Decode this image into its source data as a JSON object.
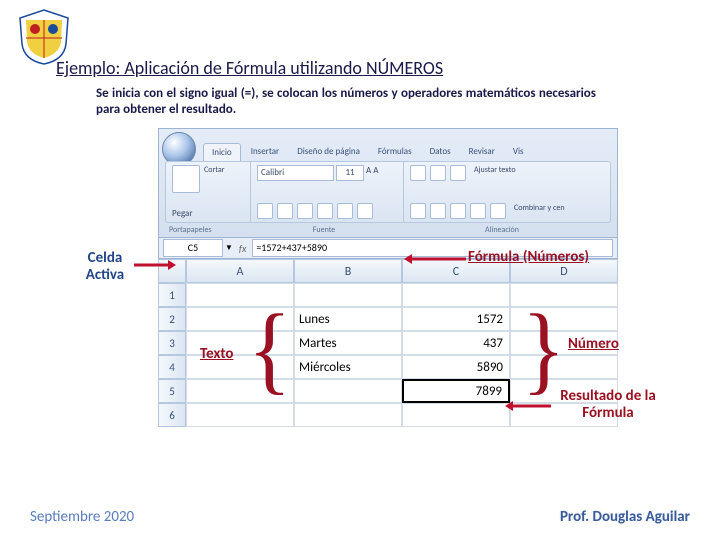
{
  "title": "Ejemplo: Aplicación de Fórmula utilizando NÚMEROS",
  "description": "Se inicia con el signo igual (=), se colocan los números y operadores matemáticos necesarios para obtener el resultado.",
  "callouts": {
    "celda_activa": "Celda Activa",
    "formula_numeros": "Fórmula (Números)",
    "texto": "Texto",
    "numero": "Número",
    "resultado": "Resultado de la Fórmula"
  },
  "ribbon": {
    "tabs": [
      "Inicio",
      "Insertar",
      "Diseño de página",
      "Fórmulas",
      "Datos",
      "Revisar",
      "Vis"
    ],
    "groups": [
      "Portapapeles",
      "Fuente",
      "Alineación"
    ],
    "paste": "Pegar",
    "cortar": "Cortar",
    "ajustar": "Ajustar texto",
    "combinar": "Combinar y cen",
    "font_name": "Calibri",
    "font_size": "11"
  },
  "formula_bar": {
    "namebox": "C5",
    "fx": "fx",
    "formula": "=1572+437+5890"
  },
  "columns": [
    "A",
    "B",
    "C",
    "D"
  ],
  "rows": [
    "1",
    "2",
    "3",
    "4",
    "5",
    "6"
  ],
  "cells": {
    "B2": "Lunes",
    "B3": "Martes",
    "B4": "Miércoles",
    "C2": "1572",
    "C3": "437",
    "C4": "5890",
    "C5": "7899"
  },
  "footer": {
    "left": "Septiembre 2020",
    "right": "Prof. Douglas Aguilar"
  }
}
